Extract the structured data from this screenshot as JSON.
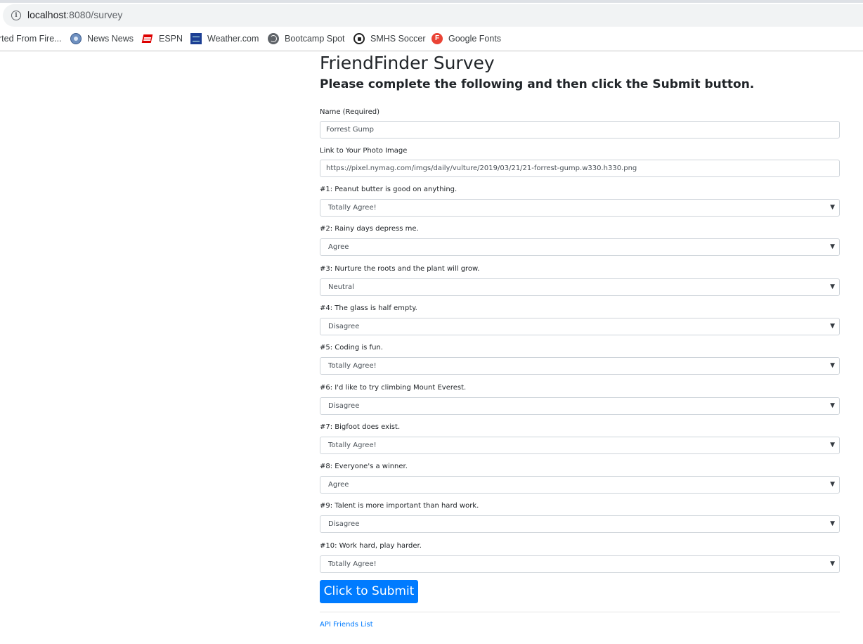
{
  "browser": {
    "url_host": "localhost",
    "url_rest": ":8080/survey",
    "bookmarks": [
      {
        "label": "rted From Fire...",
        "icon": "firefox-import-icon"
      },
      {
        "label": "News News",
        "icon": "news-icon"
      },
      {
        "label": "ESPN",
        "icon": "espn-icon"
      },
      {
        "label": "Weather.com",
        "icon": "weather-channel-icon"
      },
      {
        "label": "Bootcamp Spot",
        "icon": "globe-icon"
      },
      {
        "label": "SMHS Soccer",
        "icon": "soccer-ball-icon"
      },
      {
        "label": "Google Fonts",
        "icon": "google-fonts-icon",
        "icon_text": "F"
      }
    ]
  },
  "page": {
    "title": "FriendFinder Survey",
    "subtitle": "Please complete the following and then click the Submit button.",
    "name_label": "Name (Required)",
    "name_value": "Forrest Gump",
    "photo_label": "Link to Your Photo Image",
    "photo_value": "https://pixel.nymag.com/imgs/daily/vulture/2019/03/21/21-forrest-gump.w330.h330.png",
    "questions": [
      {
        "label": "#1: Peanut butter is good on anything.",
        "answer": "Totally Agree!"
      },
      {
        "label": "#2: Rainy days depress me.",
        "answer": "Agree"
      },
      {
        "label": "#3: Nurture the roots and the plant will grow.",
        "answer": "Neutral"
      },
      {
        "label": "#4: The glass is half empty.",
        "answer": "Disagree"
      },
      {
        "label": "#5: Coding is fun.",
        "answer": "Totally Agree!"
      },
      {
        "label": "#6: I'd like to try climbing Mount Everest.",
        "answer": "Disagree"
      },
      {
        "label": "#7: Bigfoot does exist.",
        "answer": "Totally Agree!"
      },
      {
        "label": "#8: Everyone's a winner.",
        "answer": "Agree"
      },
      {
        "label": "#9: Talent is more important than hard work.",
        "answer": "Disagree"
      },
      {
        "label": "#10: Work hard, play harder.",
        "answer": "Totally Agree!"
      }
    ],
    "submit_label": "Click to Submit",
    "api_link": "API Friends List"
  },
  "colors": {
    "primary": "#007bff",
    "text": "#212529",
    "input_border": "#ced4da"
  }
}
